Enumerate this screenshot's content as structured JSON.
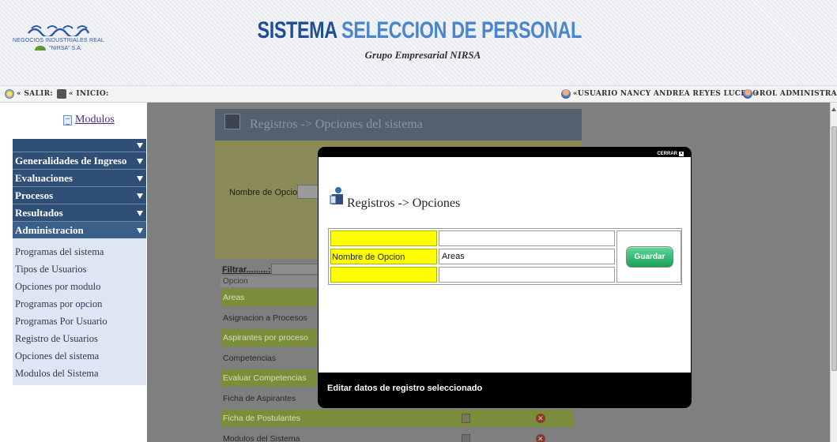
{
  "header": {
    "logo_line1": "NEGOCIOS INDUSTRIALES REAL",
    "logo_line2": "\"NIRSA\" S.A.",
    "title_part1": "SISTEMA",
    "title_part2": "SELECCION DE PERSONAL",
    "subtitle": "Grupo Empresarial NIRSA"
  },
  "topbar": {
    "salir": "« SALIR:",
    "inicio": "« INICIO:",
    "usuario": "«USUARIO NANCY ANDREA REYES LUCERO",
    "rol": "«ROL ADMINISTRADOR"
  },
  "sidebar": {
    "modulos": "Modulos",
    "menu": [
      {
        "label": "Generalidades de Ingreso"
      },
      {
        "label": "Evaluaciones"
      },
      {
        "label": "Procesos"
      },
      {
        "label": "Resultados"
      },
      {
        "label": "Administracion"
      }
    ],
    "submenu": [
      "Programas del sistema",
      "Tipos de Usuarios",
      "Opciones por modulo",
      "Programas por opcion",
      "Programas Por Usuario",
      "Registro de Usuarios",
      "Opciones del sistema",
      "Modulos del Sistema"
    ]
  },
  "panel": {
    "title": "Registros -> Opciones del sistema",
    "field_label": "Nombre de Opcion",
    "filter_label": "Filtrar.........:",
    "column_header": "Opcion",
    "rows": [
      {
        "label": "Areas",
        "highlight": true
      },
      {
        "label": "Asignacion a Procesos",
        "highlight": false
      },
      {
        "label": "Aspirantes por proceso",
        "highlight": true
      },
      {
        "label": "Competencias",
        "highlight": false
      },
      {
        "label": "Evaluar Competencias",
        "highlight": true
      },
      {
        "label": "Ficha de Aspirantes",
        "highlight": false
      },
      {
        "label": "Ficha de Postulantes",
        "highlight": true
      },
      {
        "label": "Modulos del Sistema",
        "highlight": false
      }
    ]
  },
  "modal": {
    "close_label": "CERRAR",
    "title": "Registros -> Opciones",
    "field_label": "Nombre de Opcion",
    "field_value": "Areas",
    "save_label": "Guardar",
    "footer": "Editar datos de registro seleccionado"
  },
  "colors": {
    "menu_bg": "#2f4f76",
    "highlight_row": "#7a8d3a",
    "yellow_cell": "#ffff00",
    "save_button": "#18a05a"
  }
}
